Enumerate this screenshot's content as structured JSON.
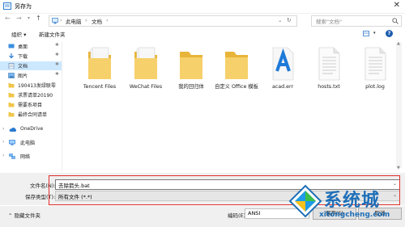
{
  "window": {
    "title": "另存为",
    "close_glyph": "✕"
  },
  "nav": {
    "back": "←",
    "forward": "→",
    "up": "↑",
    "path": [
      "此电脑",
      "文档"
    ],
    "search_placeholder": "搜索\"文档\""
  },
  "toolbar": {
    "organize": "组织 ▾",
    "new_folder": "新建文件夹",
    "help": "?"
  },
  "sidebar": {
    "quick_access": [
      {
        "label": "桌面"
      },
      {
        "label": "下载"
      },
      {
        "label": "文档"
      },
      {
        "label": "图片"
      },
      {
        "label": "190413发绿联零"
      },
      {
        "label": "求票请单20190"
      },
      {
        "label": "需要系项目"
      },
      {
        "label": "最终合同请单"
      }
    ],
    "onedrive": "OneDrive",
    "this_pc": "此电脑",
    "network": "网络"
  },
  "files": [
    {
      "label": "Tencent Files",
      "icon": "folder-docs"
    },
    {
      "label": "WeChat Files",
      "icon": "folder-docs"
    },
    {
      "label": "我的回归体",
      "icon": "folder"
    },
    {
      "label": "自定义 Office 模板",
      "icon": "folder"
    },
    {
      "label": "acad.err",
      "icon": "text-file-a"
    },
    {
      "label": "hosts.txt",
      "icon": "text-file"
    },
    {
      "label": "plot.log",
      "icon": "text-file"
    }
  ],
  "form": {
    "filename_label": "文件名(N):",
    "filename_value": "去除箭头.bat",
    "filetype_label": "保存类型(T):",
    "filetype_value": "所有文件 (*.*)"
  },
  "footer": {
    "hide_folders": "隐藏文件夹",
    "encoding_label": "编码(E):",
    "encoding_value": "ANSI",
    "save": "保存(S)",
    "cancel": "取消"
  },
  "watermark": {
    "brand": "系统城",
    "url": "xitongcheng.com"
  },
  "colors": {
    "accent": "#0078d7",
    "selection": "#cce8ff",
    "highlight": "#e0302a",
    "folder": "#f0c64a"
  }
}
